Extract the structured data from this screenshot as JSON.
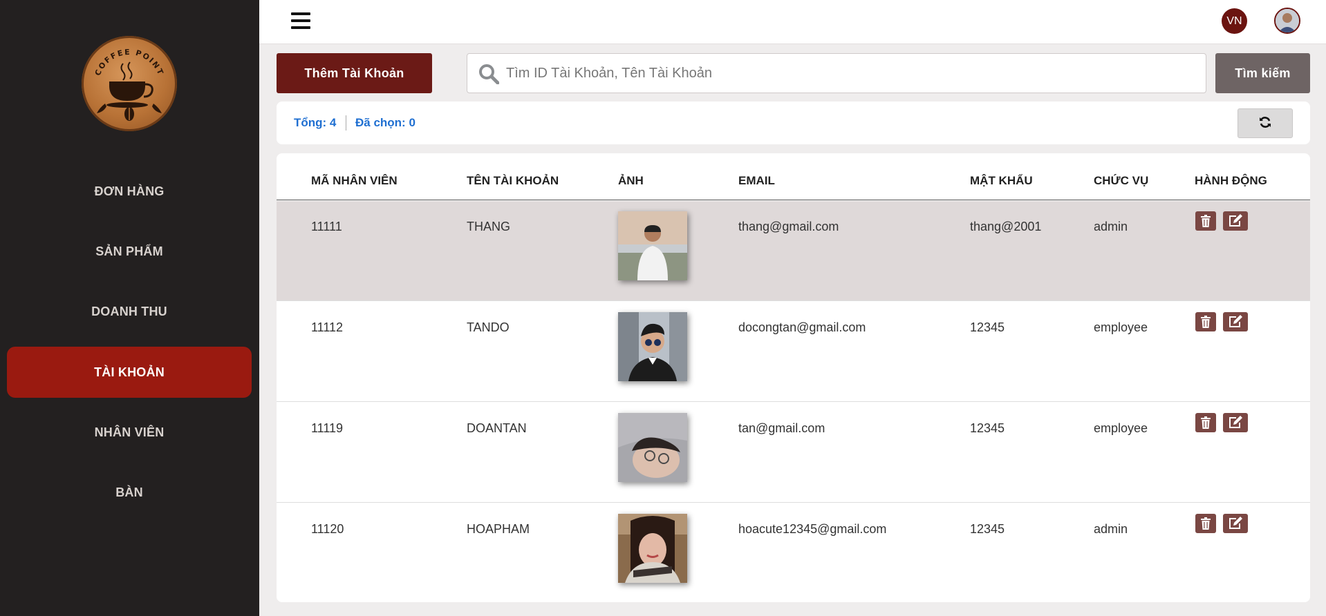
{
  "brand": {
    "name": "COFFEE POINT"
  },
  "sidebar": {
    "items": [
      {
        "label": "ĐƠN HÀNG",
        "active": false
      },
      {
        "label": "SẢN PHẨM",
        "active": false
      },
      {
        "label": "DOANH THU",
        "active": false
      },
      {
        "label": "TÀI KHOẢN",
        "active": true
      },
      {
        "label": "NHÂN VIÊN",
        "active": false
      },
      {
        "label": "BÀN",
        "active": false
      }
    ]
  },
  "header": {
    "language": "VN",
    "menu_icon": "hamburger-icon",
    "avatar_icon": "user-avatar"
  },
  "toolbar": {
    "add_label": "Thêm Tài Khoản",
    "search_placeholder": "Tìm ID Tài Khoản, Tên Tài Khoản",
    "search_value": "",
    "search_button_label": "Tìm kiếm"
  },
  "summary": {
    "total": "Tổng: 4",
    "selected": "Đã chọn: 0",
    "refresh_icon": "refresh-icon"
  },
  "table": {
    "columns": [
      "MÃ NHÂN VIÊN",
      "TÊN TÀI KHOẢN",
      "ẢNH",
      "EMAIL",
      "MẬT KHẨU",
      "CHỨC VỤ",
      "HÀNH ĐỘNG"
    ],
    "rows": [
      {
        "id": "11111",
        "username": "THANG",
        "email": "thang@gmail.com",
        "password": "thang@2001",
        "role": "admin",
        "selected": true
      },
      {
        "id": "11112",
        "username": "TANDO",
        "email": "docongtan@gmail.com",
        "password": "12345",
        "role": "employee",
        "selected": false
      },
      {
        "id": "11119",
        "username": "DOANTAN",
        "email": "tan@gmail.com",
        "password": "12345",
        "role": "employee",
        "selected": false
      },
      {
        "id": "11120",
        "username": "HOAPHAM",
        "email": "hoacute12345@gmail.com",
        "password": "12345",
        "role": "admin",
        "selected": false
      }
    ],
    "row_actions": [
      "trash-icon",
      "edit-icon"
    ]
  },
  "colors": {
    "sidebar_bg": "#232020",
    "active_nav": "#9a1a10",
    "add_button": "#6b1a16",
    "search_button": "#6e6464",
    "action_button": "#7a4743",
    "selected_row": "#dfd9d9",
    "summary_text": "#1f6fd1"
  }
}
